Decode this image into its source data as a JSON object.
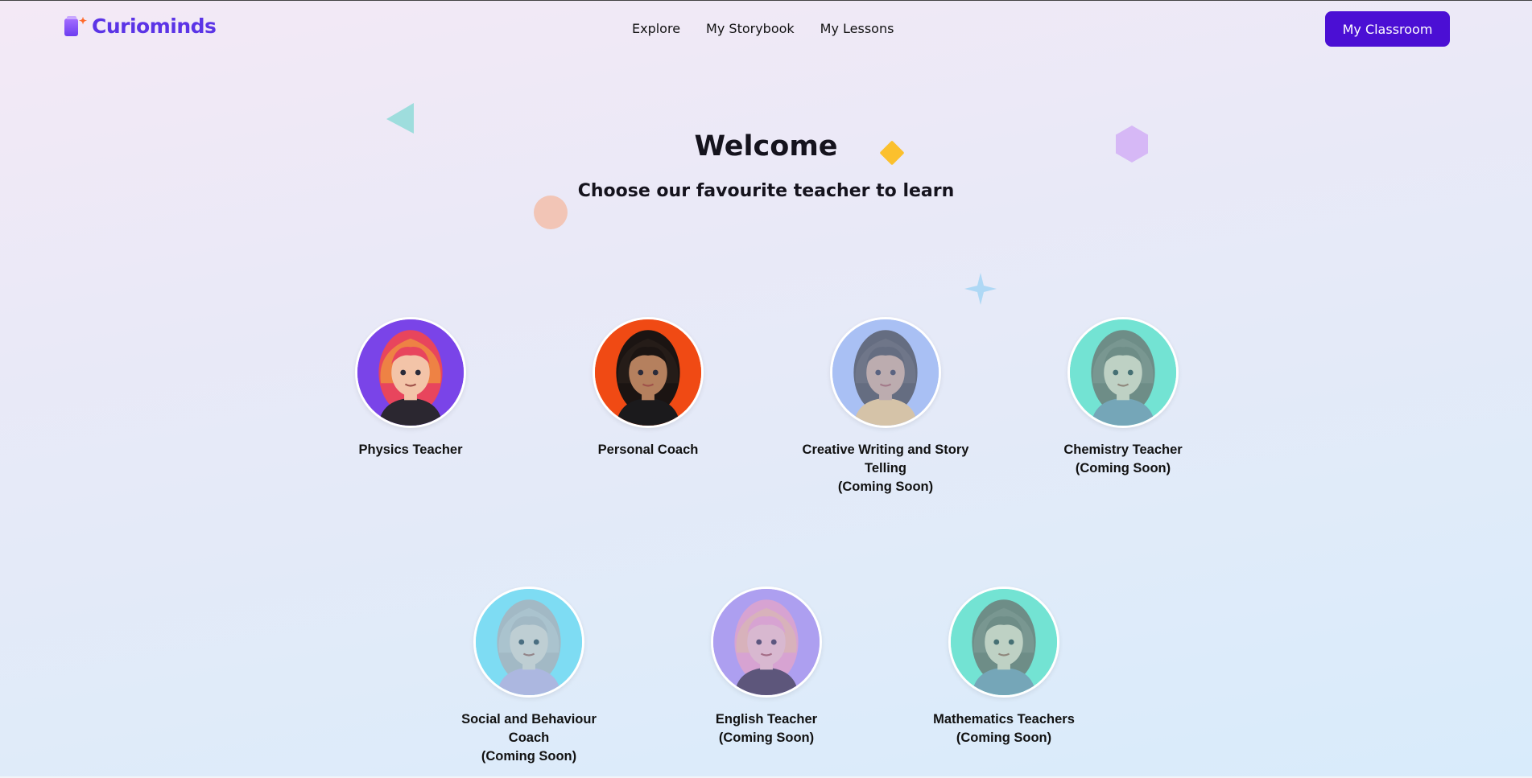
{
  "brand": {
    "name": "Curiominds",
    "logo_icon": "book-spark-icon"
  },
  "nav": {
    "items": [
      "Explore",
      "My Storybook",
      "My Lessons"
    ]
  },
  "header": {
    "cta_label": "My Classroom",
    "cta_color": "#4b0fd4"
  },
  "hero": {
    "title": "Welcome",
    "subtitle": "Choose our favourite teacher to learn"
  },
  "teachers": [
    {
      "name": "Physics Teacher",
      "status": "",
      "bg": "#7a44e8",
      "hair": "#e8455d",
      "hair2": "#f2b530",
      "skin": "#f3c4a8",
      "shirt": "#2b2730"
    },
    {
      "name": "Personal Coach",
      "status": "",
      "bg": "#f04a14",
      "hair": "#1b1412",
      "hair2": "#2e221d",
      "skin": "#b5805e",
      "shirt": "#1b1a1c"
    },
    {
      "name": "Creative Writing and Story Telling",
      "status": "(Coming Soon)",
      "bg": "#a9c0f4",
      "hair": "#3c3a3a",
      "hair2": "#5a5552",
      "skin": "#c9a085",
      "shirt": "#f1c57a"
    },
    {
      "name": "Chemistry Teacher",
      "status": "(Coming Soon)",
      "bg": "#73e3d3",
      "hair": "#6b5a5a",
      "hair2": "#8d7878",
      "skin": "#ecc7bb",
      "shirt": "#7682a8"
    },
    {
      "name": "Social and Behaviour Coach",
      "status": "(Coming Soon)",
      "bg": "#7edcf3",
      "hair": "#b8a4a8",
      "hair2": "#d2c0c2",
      "skin": "#e6c5bf",
      "shirt": "#c9a1d4"
    },
    {
      "name": "English Teacher",
      "status": "(Coming Soon)",
      "bg": "#ad9ff0",
      "hair": "#f0a7c0",
      "hair2": "#f4d27c",
      "skin": "#f2c9bd",
      "shirt": "#2d2b34"
    },
    {
      "name": "Mathematics Teachers",
      "status": "(Coming Soon)",
      "bg": "#73e3d3",
      "hair": "#6b5a5a",
      "hair2": "#8d7878",
      "skin": "#ecc7bb",
      "shirt": "#7682a8"
    }
  ]
}
